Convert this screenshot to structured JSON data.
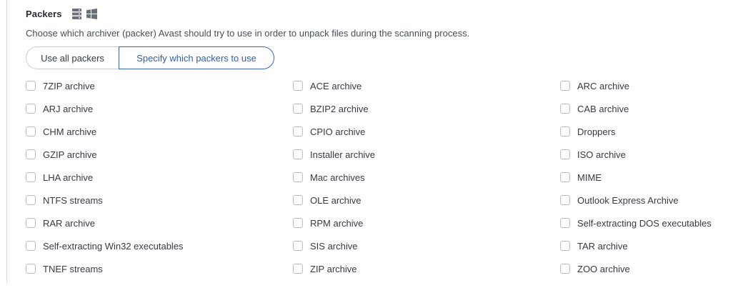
{
  "section": {
    "title": "Packers",
    "icons": [
      "server-icon",
      "windows-icon"
    ],
    "description": "Choose which archiver (packer) Avast should try to use in order to unpack files during the scanning process."
  },
  "mode_toggle": {
    "options": [
      "Use all packers",
      "Specify which packers to use"
    ],
    "selected": "Specify which packers to use"
  },
  "colors": {
    "accent": "#2f5fb3",
    "text": "#363a45",
    "border": "#c9ccd3"
  },
  "packers": [
    {
      "label": "7ZIP archive",
      "checked": false
    },
    {
      "label": "ACE archive",
      "checked": false
    },
    {
      "label": "ARC archive",
      "checked": false
    },
    {
      "label": "ARJ archive",
      "checked": false
    },
    {
      "label": "BZIP2 archive",
      "checked": false
    },
    {
      "label": "CAB archive",
      "checked": false
    },
    {
      "label": "CHM archive",
      "checked": false
    },
    {
      "label": "CPIO archive",
      "checked": false
    },
    {
      "label": "Droppers",
      "checked": false
    },
    {
      "label": "GZIP archive",
      "checked": false
    },
    {
      "label": "Installer archive",
      "checked": false
    },
    {
      "label": "ISO archive",
      "checked": false
    },
    {
      "label": "LHA archive",
      "checked": false
    },
    {
      "label": "Mac archives",
      "checked": false
    },
    {
      "label": "MIME",
      "checked": false
    },
    {
      "label": "NTFS streams",
      "checked": false
    },
    {
      "label": "OLE archive",
      "checked": false
    },
    {
      "label": "Outlook Express Archive",
      "checked": false
    },
    {
      "label": "RAR archive",
      "checked": false
    },
    {
      "label": "RPM archive",
      "checked": false
    },
    {
      "label": "Self-extracting DOS executables",
      "checked": false
    },
    {
      "label": "Self-extracting Win32 executables",
      "checked": false
    },
    {
      "label": "SIS archive",
      "checked": false
    },
    {
      "label": "TAR archive",
      "checked": false
    },
    {
      "label": "TNEF streams",
      "checked": false
    },
    {
      "label": "ZIP archive",
      "checked": false
    },
    {
      "label": "ZOO archive",
      "checked": false
    }
  ]
}
